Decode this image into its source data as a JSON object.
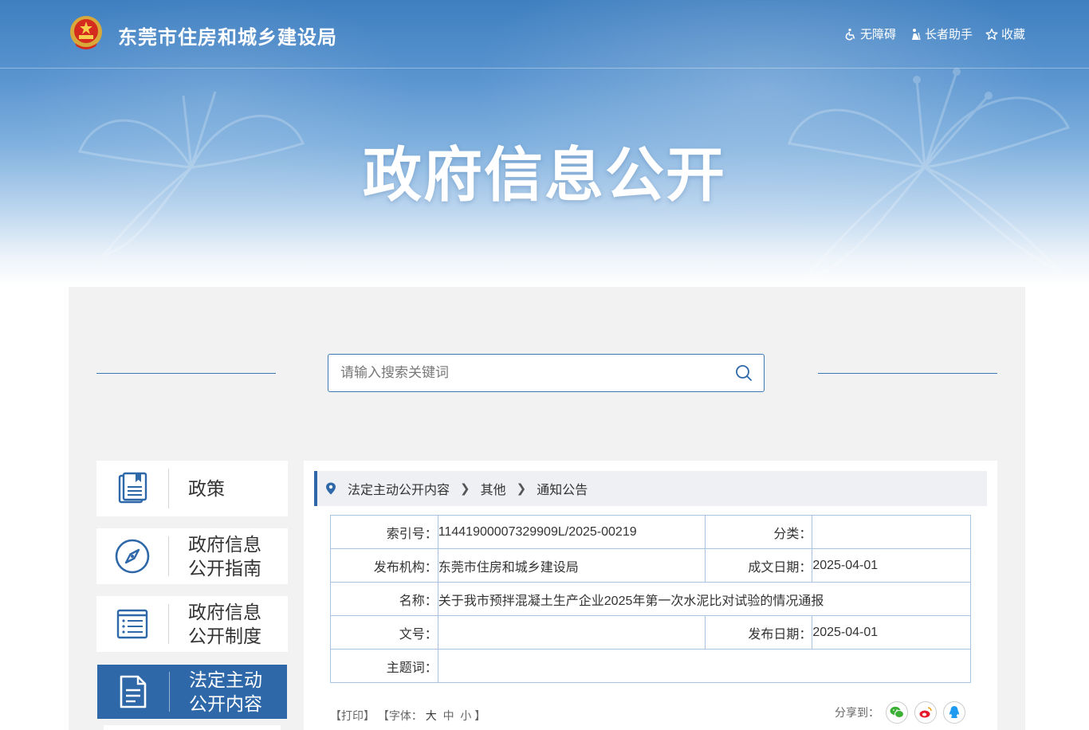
{
  "header": {
    "site_title": "东莞市住房和城乡建设局",
    "links": [
      {
        "label": "无障碍",
        "icon": "wheelchair-icon"
      },
      {
        "label": "长者助手",
        "icon": "elder-icon"
      },
      {
        "label": "收藏",
        "icon": "star-icon"
      }
    ],
    "banner_title": "政府信息公开"
  },
  "search": {
    "placeholder": "请输入搜索关键词",
    "value": ""
  },
  "sidebar": {
    "items": [
      {
        "label": "政策",
        "icon": "book-icon"
      },
      {
        "label": "政府信息\n公开指南",
        "icon": "compass-icon"
      },
      {
        "label": "政府信息\n公开制度",
        "icon": "list-icon"
      },
      {
        "label": "法定主动\n公开内容",
        "icon": "document-icon",
        "active": true
      }
    ]
  },
  "breadcrumb": [
    "法定主动公开内容",
    "其他",
    "通知公告"
  ],
  "meta": {
    "index_label": "索引号：",
    "index_value": "11441900007329909L/2025-00219",
    "category_label": "分类：",
    "category_value": "",
    "publisher_label": "发布机构：",
    "publisher_value": "东莞市住房和城乡建设局",
    "created_label": "成文日期：",
    "created_value": "2025-04-01",
    "name_label": "名称：",
    "name_value": "关于我市预拌混凝土生产企业2025年第一次水泥比对试验的情况通报",
    "docno_label": "文号：",
    "docno_value": "",
    "publish_label": "发布日期：",
    "publish_value": "2025-04-01",
    "keywords_label": "主题词：",
    "keywords_value": ""
  },
  "tools": {
    "print": "【打印】",
    "font_prefix": "【字体：",
    "font_large": "大",
    "font_medium": "中",
    "font_small": "小",
    "font_suffix": "】",
    "share_label": "分享到："
  },
  "colors": {
    "accent": "#2f68a8",
    "banner_top": "#3f7fc0",
    "border": "#a9c4e2",
    "wechat": "#3cb035",
    "weibo": "#e6162d",
    "qq": "#1e9bf0"
  }
}
